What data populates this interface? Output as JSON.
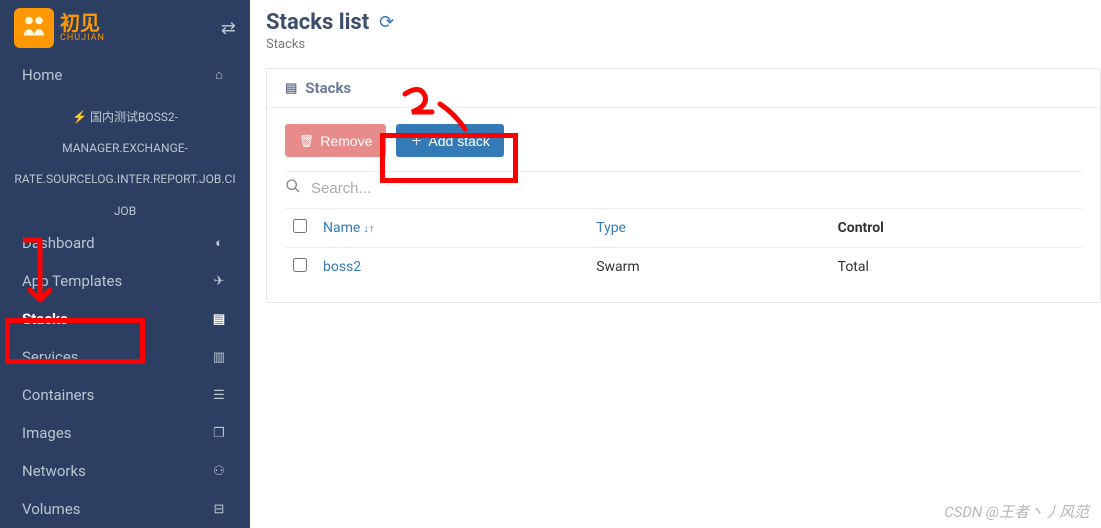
{
  "logo": {
    "text_cn": "初见",
    "text_en": "CHUJIAN"
  },
  "sidebar": {
    "home_label": "Home",
    "endpoint_line1": "国内测试BOSS2-",
    "endpoint_line2": "MANAGER.EXCHANGE-",
    "endpoint_line3": "RATE.SOURCELOG.INTER.REPORT.JOB.CI",
    "endpoint_line4": "JOB",
    "items": [
      {
        "label": "Dashboard",
        "icon": "tachometer"
      },
      {
        "label": "App Templates",
        "icon": "rocket"
      },
      {
        "label": "Stacks",
        "icon": "th-list",
        "active": true
      },
      {
        "label": "Services",
        "icon": "list-alt"
      },
      {
        "label": "Containers",
        "icon": "server"
      },
      {
        "label": "Images",
        "icon": "clone"
      },
      {
        "label": "Networks",
        "icon": "sitemap"
      },
      {
        "label": "Volumes",
        "icon": "hdd"
      }
    ]
  },
  "page": {
    "title": "Stacks list",
    "breadcrumb": "Stacks"
  },
  "panel": {
    "header": "Stacks",
    "remove_label": "Remove",
    "add_label": "Add stack",
    "search_placeholder": "Search..."
  },
  "table": {
    "columns": {
      "name": "Name",
      "type": "Type",
      "control": "Control"
    },
    "rows": [
      {
        "name": "boss2",
        "type": "Swarm",
        "control": "Total"
      }
    ]
  },
  "watermark": "CSDN @王者丶丿风范"
}
